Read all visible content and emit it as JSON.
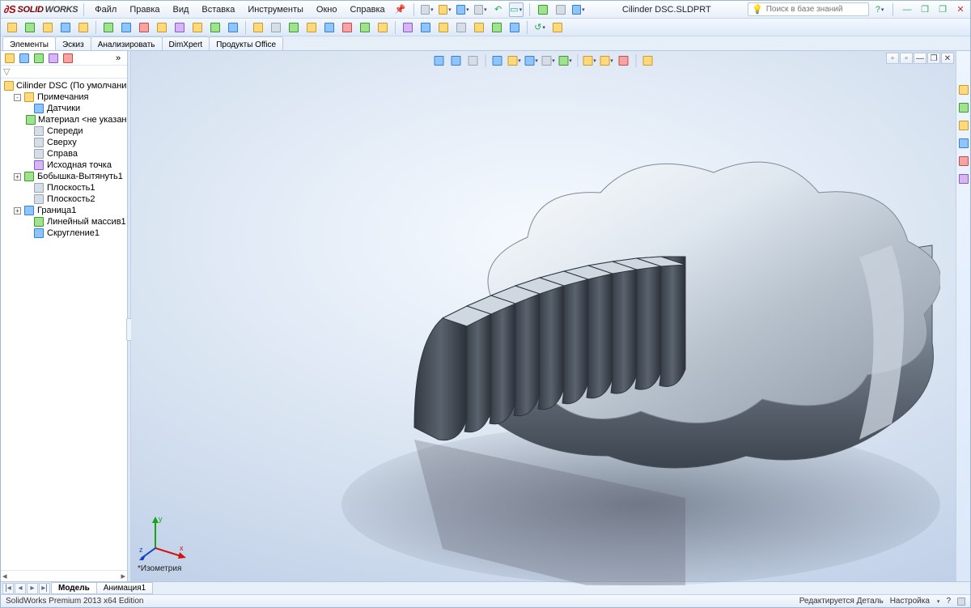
{
  "app": {
    "brand_solid": "SOLID",
    "brand_works": "WORKS"
  },
  "menu": {
    "items": [
      "Файл",
      "Правка",
      "Вид",
      "Вставка",
      "Инструменты",
      "Окно",
      "Справка"
    ]
  },
  "doc": {
    "title": "Cilinder DSC.SLDPRT"
  },
  "search": {
    "placeholder": "Поиск в базе знаний"
  },
  "cmd_tabs": [
    "Элементы",
    "Эскиз",
    "Анализировать",
    "DimXpert",
    "Продукты Office"
  ],
  "active_cmd_tab": 0,
  "tree": {
    "root": "Cilinder DSC  (По умолчанию<<По",
    "nodes": [
      {
        "expand": "-",
        "icon": "folder",
        "label": "Примечания",
        "indent": 1
      },
      {
        "expand": "",
        "icon": "sensor",
        "label": "Датчики",
        "indent": 2
      },
      {
        "expand": "",
        "icon": "material",
        "label": "Материал <не указан>",
        "indent": 2
      },
      {
        "expand": "",
        "icon": "plane",
        "label": "Спереди",
        "indent": 2
      },
      {
        "expand": "",
        "icon": "plane",
        "label": "Сверху",
        "indent": 2
      },
      {
        "expand": "",
        "icon": "plane",
        "label": "Справа",
        "indent": 2
      },
      {
        "expand": "",
        "icon": "origin",
        "label": "Исходная точка",
        "indent": 2
      },
      {
        "expand": "+",
        "icon": "extrude",
        "label": "Бобышка-Вытянуть1",
        "indent": 1
      },
      {
        "expand": "",
        "icon": "plane",
        "label": "Плоскость1",
        "indent": 2
      },
      {
        "expand": "",
        "icon": "plane",
        "label": "Плоскость2",
        "indent": 2
      },
      {
        "expand": "+",
        "icon": "boundary",
        "label": "Граница1",
        "indent": 1
      },
      {
        "expand": "",
        "icon": "pattern",
        "label": "Линейный массив1",
        "indent": 2
      },
      {
        "expand": "",
        "icon": "fillet",
        "label": "Скругление1",
        "indent": 2
      }
    ]
  },
  "view_label": "*Изометрия",
  "bottom_tabs": [
    "Модель",
    "Анимация1"
  ],
  "active_bottom_tab": 0,
  "status": {
    "left": "SolidWorks Premium 2013 x64 Edition",
    "right1": "Редактируется Деталь",
    "right2": "Настройка"
  },
  "triad": {
    "x": "x",
    "y": "y",
    "z": "z"
  }
}
